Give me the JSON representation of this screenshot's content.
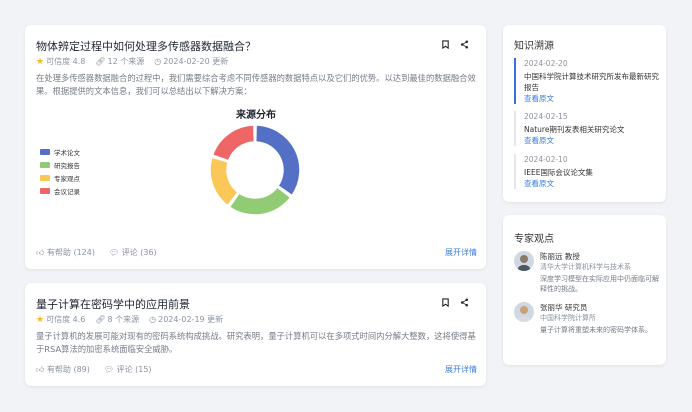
{
  "cards": [
    {
      "title": "物体辨定过程中如何处理多传感器数据融合？",
      "rating": "可信度 4.8",
      "sources": "12 个来源",
      "updated": "2024-02-20 更新",
      "description": "在处理多传感器数据融合的过程中，我们需要综合考虑不同传感器的数据特点以及它们的优势。以达到最佳的数据融合效果。根据提供的文本信息，我们可以总结出以下解决方案：",
      "helpful": "有帮助 (124)",
      "comments": "评论 (36)",
      "expand": "展开详情"
    },
    {
      "title": "量子计算在密码学中的应用前景",
      "rating": "可信度 4.6",
      "sources": "8 个来源",
      "updated": "2024-02-19 更新",
      "description": "量子计算机的发展可能对现有的密码系统构成挑战。研究表明，量子计算机可以在多项式时间内分解大整数，这将使得基于RSA算法的加密系统面临安全威胁。",
      "helpful": "有帮助 (89)",
      "comments": "评论 (15)",
      "expand": "展开详情"
    }
  ],
  "chart_data": {
    "type": "pie",
    "title": "来源分布",
    "categories": [
      "学术论文",
      "研究报告",
      "专家观点",
      "会议记录"
    ],
    "values": [
      35,
      25,
      20,
      20
    ],
    "colors": [
      "#5470c6",
      "#91cc75",
      "#fac858",
      "#ee6666"
    ],
    "legend_position": "left"
  },
  "knowledge": {
    "title": "知识溯源",
    "items": [
      {
        "date": "2024-02-20",
        "name": "中国科学院计算技术研究所发布最新研究报告",
        "link": "查看原文"
      },
      {
        "date": "2024-02-15",
        "name": "Nature期刊发表相关研究论文",
        "link": "查看原文"
      },
      {
        "date": "2024-02-10",
        "name": "IEEE国际会议论文集",
        "link": "查看原文"
      }
    ]
  },
  "experts": {
    "title": "专家观点",
    "items": [
      {
        "name": "陈丽远 教授",
        "org": "清华大学计算机科学与技术系",
        "view": "深度学习模型在实际应用中仍面临可解释性的挑战。"
      },
      {
        "name": "张丽华 研究员",
        "org": "中国科学院计算所",
        "view": "量子计算将重塑未来的密码学体系。"
      }
    ]
  }
}
